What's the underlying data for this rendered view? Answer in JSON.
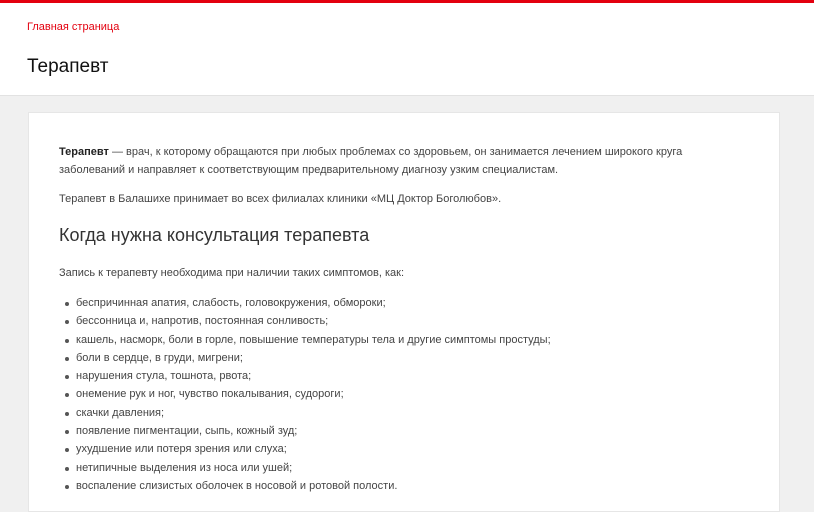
{
  "header": {
    "breadcrumb": "Главная страница",
    "title": "Терапевт"
  },
  "content": {
    "intro_term": "Терапевт",
    "intro_rest": " — врач, к которому обращаются при любых проблемах со здоровьем, он занимается лечением широкого круга заболеваний и направляет к соответствующим предварительному диагнозу узким специалистам.",
    "branches": "Терапевт в Балашихе принимает во всех филиалах клиники «МЦ Доктор Боголюбов».",
    "section_heading": "Когда нужна консультация терапевта",
    "symptom_lead": "Запись к терапевту необходима при наличии таких симптомов, как:",
    "symptoms": [
      "беспричинная апатия, слабость, головокружения, обмороки;",
      "бессонница и, напротив, постоянная сонливость;",
      "кашель, насморк, боли в горле, повышение температуры тела и другие симптомы простуды;",
      "боли в сердце, в груди, мигрени;",
      "нарушения стула, тошнота, рвота;",
      "онемение рук и ног, чувство покалывания, судороги;",
      "скачки давления;",
      "появление пигментации, сыпь, кожный зуд;",
      "ухудшение или потеря зрения или слуха;",
      "нетипичные выделения из носа или ушей;",
      "воспаление слизистых оболочек в носовой и ротовой полости."
    ]
  },
  "colors": {
    "accent": "#e3000f",
    "background": "#f0f0f0",
    "card": "#ffffff"
  }
}
